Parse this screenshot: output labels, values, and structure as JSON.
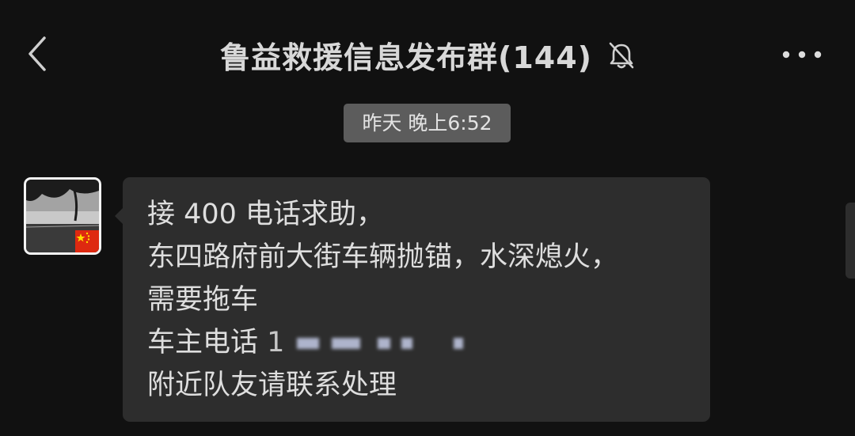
{
  "header": {
    "back_icon": "chevron-left-icon",
    "title": "鲁益救援信息发布群(144)",
    "mute_icon": "bell-off-icon",
    "more_icon": "ellipsis-icon"
  },
  "timestamp": "昨天 晚上6:52",
  "message": {
    "avatar_badge_icon": "china-flag-icon",
    "lines": [
      "接 400 电话求助，",
      "东四路府前大街车辆抛锚，水深熄火，",
      "需要拖车",
      "车主电话",
      "附近队友请联系处理"
    ],
    "phone_visible_prefix": "1",
    "phone_blurred": true
  },
  "colors": {
    "background": "#111111",
    "bubble": "#2d2d2d",
    "timestamp_pill": "#5c5c5c",
    "text": "#dedede"
  }
}
